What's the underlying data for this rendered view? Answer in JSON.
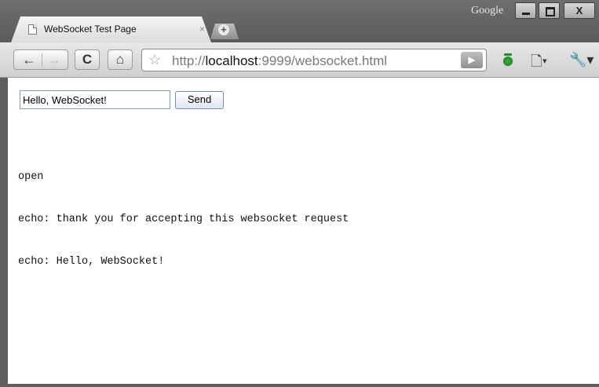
{
  "window": {
    "brand_label": "Google",
    "close_glyph": "X"
  },
  "tab": {
    "title": "WebSocket Test Page",
    "close_glyph": "×",
    "new_tab_glyph": "+"
  },
  "toolbar": {
    "back_icon": "←",
    "forward_icon": "→",
    "reload_icon": "C",
    "home_icon": "⌂",
    "url_prefix": "http://",
    "url_host": "localhost",
    "url_rest": ":9999/websocket.html",
    "go_icon": "▶",
    "page_menu_icon": "🗋▾",
    "wrench_menu_icon": "🔧▾"
  },
  "page": {
    "message_value": "Hello, WebSocket!",
    "send_label": "Send",
    "log": [
      "open",
      "echo: thank you for accepting this websocket request",
      "echo: Hello, WebSocket!"
    ]
  }
}
